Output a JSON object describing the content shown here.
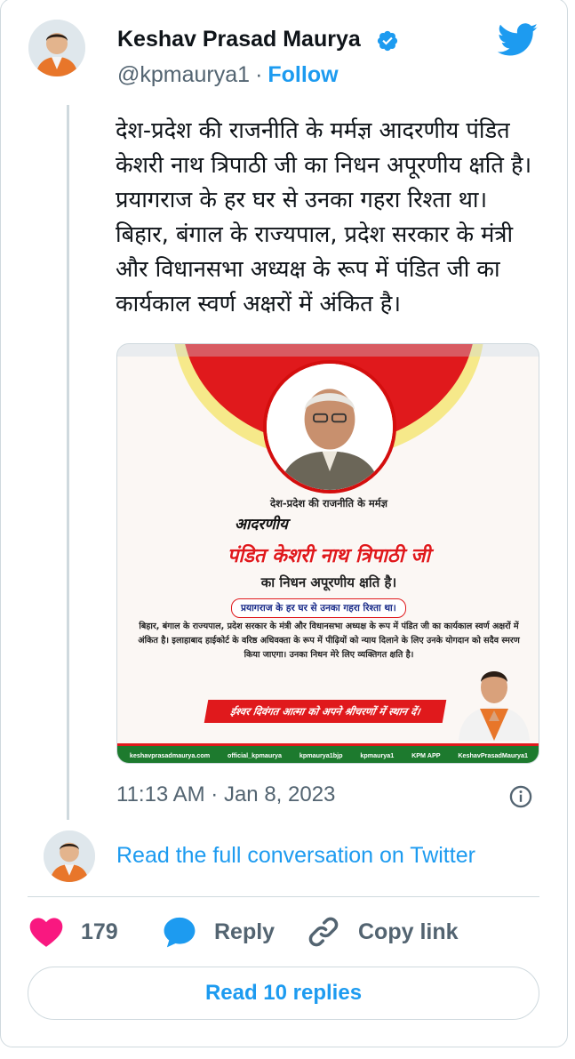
{
  "author": {
    "name": "Keshav Prasad Maurya",
    "handle": "@kpmaurya1",
    "separator": "·",
    "follow_label": "Follow"
  },
  "tweet": {
    "text": "देश-प्रदेश की राजनीति के मर्मज्ञ आदरणीय पंडित केशरी नाथ त्रिपाठी जी का निधन अपूरणीय क्षति है। प्रयागराज के हर घर से उनका गहरा रिश्ता था। बिहार, बंगाल के राज्यपाल, प्रदेश सरकार के मंत्री और विधानसभा अध्यक्ष के रूप में पंडित जी का कार्यकाल स्वर्ण अक्षरों में अंकित है।",
    "timestamp": "11:13 AM · Jan 8, 2023"
  },
  "media": {
    "line1": "देश-प्रदेश की राजनीति के मर्मज्ञ",
    "line2": "आदरणीय",
    "line3": "पंडित केशरी नाथ त्रिपाठी जी",
    "line4": "का निधन अपूरणीय क्षति है।",
    "line5": "प्रयागराज के हर घर से उनका गहरा रिश्ता था।",
    "body": "बिहार, बंगाल के राज्यपाल, प्रदेश सरकार के मंत्री और विधानसभा अध्यक्ष के रूप में पंडित जी का कार्यकाल स्वर्ण अक्षरों में अंकित है। इलाहाबाद हाईकोर्ट के वरिष्ठ अधिवक्ता के रूप में पीढ़ियों को न्याय दिलाने के लिए उनके योगदान को सदैव स्मरण किया जाएगा। उनका निधन मेरे लिए व्यक्तिगत क्षति है।",
    "banner": "ईश्वर दिवंगत आत्मा को अपने श्रीचरणों में स्थान दें।",
    "footer": {
      "website": "keshavprasadmaurya.com",
      "instagram": "official_kpmaurya",
      "facebook": "kpmaurya1bjp",
      "twitter": "kpmaurya1",
      "app": "KPM APP",
      "youtube": "KeshavPrasadMaurya1"
    }
  },
  "conversation_link": "Read the full conversation on Twitter",
  "actions": {
    "like_count": "179",
    "reply_label": "Reply",
    "copy_label": "Copy link"
  },
  "read_replies_label": "Read 10 replies",
  "colors": {
    "accent": "#1d9bf0",
    "like": "#f91880",
    "secondary_text": "#536471",
    "border": "#cfd9de",
    "poster_red": "#e0191c",
    "poster_green": "#1d7a2e"
  }
}
